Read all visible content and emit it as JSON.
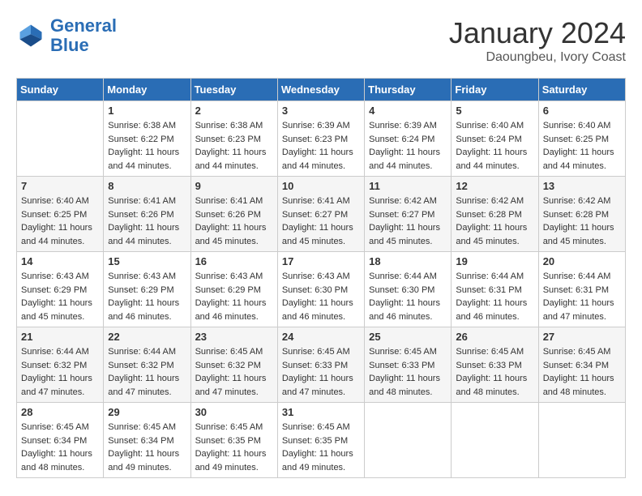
{
  "header": {
    "logo_general": "General",
    "logo_blue": "Blue",
    "month_title": "January 2024",
    "subtitle": "Daoungbeu, Ivory Coast"
  },
  "days_of_week": [
    "Sunday",
    "Monday",
    "Tuesday",
    "Wednesday",
    "Thursday",
    "Friday",
    "Saturday"
  ],
  "weeks": [
    [
      {
        "day": "",
        "sunrise": "",
        "sunset": "",
        "daylight": ""
      },
      {
        "day": "1",
        "sunrise": "Sunrise: 6:38 AM",
        "sunset": "Sunset: 6:22 PM",
        "daylight": "Daylight: 11 hours and 44 minutes."
      },
      {
        "day": "2",
        "sunrise": "Sunrise: 6:38 AM",
        "sunset": "Sunset: 6:23 PM",
        "daylight": "Daylight: 11 hours and 44 minutes."
      },
      {
        "day": "3",
        "sunrise": "Sunrise: 6:39 AM",
        "sunset": "Sunset: 6:23 PM",
        "daylight": "Daylight: 11 hours and 44 minutes."
      },
      {
        "day": "4",
        "sunrise": "Sunrise: 6:39 AM",
        "sunset": "Sunset: 6:24 PM",
        "daylight": "Daylight: 11 hours and 44 minutes."
      },
      {
        "day": "5",
        "sunrise": "Sunrise: 6:40 AM",
        "sunset": "Sunset: 6:24 PM",
        "daylight": "Daylight: 11 hours and 44 minutes."
      },
      {
        "day": "6",
        "sunrise": "Sunrise: 6:40 AM",
        "sunset": "Sunset: 6:25 PM",
        "daylight": "Daylight: 11 hours and 44 minutes."
      }
    ],
    [
      {
        "day": "7",
        "sunrise": "Sunrise: 6:40 AM",
        "sunset": "Sunset: 6:25 PM",
        "daylight": "Daylight: 11 hours and 44 minutes."
      },
      {
        "day": "8",
        "sunrise": "Sunrise: 6:41 AM",
        "sunset": "Sunset: 6:26 PM",
        "daylight": "Daylight: 11 hours and 44 minutes."
      },
      {
        "day": "9",
        "sunrise": "Sunrise: 6:41 AM",
        "sunset": "Sunset: 6:26 PM",
        "daylight": "Daylight: 11 hours and 45 minutes."
      },
      {
        "day": "10",
        "sunrise": "Sunrise: 6:41 AM",
        "sunset": "Sunset: 6:27 PM",
        "daylight": "Daylight: 11 hours and 45 minutes."
      },
      {
        "day": "11",
        "sunrise": "Sunrise: 6:42 AM",
        "sunset": "Sunset: 6:27 PM",
        "daylight": "Daylight: 11 hours and 45 minutes."
      },
      {
        "day": "12",
        "sunrise": "Sunrise: 6:42 AM",
        "sunset": "Sunset: 6:28 PM",
        "daylight": "Daylight: 11 hours and 45 minutes."
      },
      {
        "day": "13",
        "sunrise": "Sunrise: 6:42 AM",
        "sunset": "Sunset: 6:28 PM",
        "daylight": "Daylight: 11 hours and 45 minutes."
      }
    ],
    [
      {
        "day": "14",
        "sunrise": "Sunrise: 6:43 AM",
        "sunset": "Sunset: 6:29 PM",
        "daylight": "Daylight: 11 hours and 45 minutes."
      },
      {
        "day": "15",
        "sunrise": "Sunrise: 6:43 AM",
        "sunset": "Sunset: 6:29 PM",
        "daylight": "Daylight: 11 hours and 46 minutes."
      },
      {
        "day": "16",
        "sunrise": "Sunrise: 6:43 AM",
        "sunset": "Sunset: 6:29 PM",
        "daylight": "Daylight: 11 hours and 46 minutes."
      },
      {
        "day": "17",
        "sunrise": "Sunrise: 6:43 AM",
        "sunset": "Sunset: 6:30 PM",
        "daylight": "Daylight: 11 hours and 46 minutes."
      },
      {
        "day": "18",
        "sunrise": "Sunrise: 6:44 AM",
        "sunset": "Sunset: 6:30 PM",
        "daylight": "Daylight: 11 hours and 46 minutes."
      },
      {
        "day": "19",
        "sunrise": "Sunrise: 6:44 AM",
        "sunset": "Sunset: 6:31 PM",
        "daylight": "Daylight: 11 hours and 46 minutes."
      },
      {
        "day": "20",
        "sunrise": "Sunrise: 6:44 AM",
        "sunset": "Sunset: 6:31 PM",
        "daylight": "Daylight: 11 hours and 47 minutes."
      }
    ],
    [
      {
        "day": "21",
        "sunrise": "Sunrise: 6:44 AM",
        "sunset": "Sunset: 6:32 PM",
        "daylight": "Daylight: 11 hours and 47 minutes."
      },
      {
        "day": "22",
        "sunrise": "Sunrise: 6:44 AM",
        "sunset": "Sunset: 6:32 PM",
        "daylight": "Daylight: 11 hours and 47 minutes."
      },
      {
        "day": "23",
        "sunrise": "Sunrise: 6:45 AM",
        "sunset": "Sunset: 6:32 PM",
        "daylight": "Daylight: 11 hours and 47 minutes."
      },
      {
        "day": "24",
        "sunrise": "Sunrise: 6:45 AM",
        "sunset": "Sunset: 6:33 PM",
        "daylight": "Daylight: 11 hours and 47 minutes."
      },
      {
        "day": "25",
        "sunrise": "Sunrise: 6:45 AM",
        "sunset": "Sunset: 6:33 PM",
        "daylight": "Daylight: 11 hours and 48 minutes."
      },
      {
        "day": "26",
        "sunrise": "Sunrise: 6:45 AM",
        "sunset": "Sunset: 6:33 PM",
        "daylight": "Daylight: 11 hours and 48 minutes."
      },
      {
        "day": "27",
        "sunrise": "Sunrise: 6:45 AM",
        "sunset": "Sunset: 6:34 PM",
        "daylight": "Daylight: 11 hours and 48 minutes."
      }
    ],
    [
      {
        "day": "28",
        "sunrise": "Sunrise: 6:45 AM",
        "sunset": "Sunset: 6:34 PM",
        "daylight": "Daylight: 11 hours and 48 minutes."
      },
      {
        "day": "29",
        "sunrise": "Sunrise: 6:45 AM",
        "sunset": "Sunset: 6:34 PM",
        "daylight": "Daylight: 11 hours and 49 minutes."
      },
      {
        "day": "30",
        "sunrise": "Sunrise: 6:45 AM",
        "sunset": "Sunset: 6:35 PM",
        "daylight": "Daylight: 11 hours and 49 minutes."
      },
      {
        "day": "31",
        "sunrise": "Sunrise: 6:45 AM",
        "sunset": "Sunset: 6:35 PM",
        "daylight": "Daylight: 11 hours and 49 minutes."
      },
      {
        "day": "",
        "sunrise": "",
        "sunset": "",
        "daylight": ""
      },
      {
        "day": "",
        "sunrise": "",
        "sunset": "",
        "daylight": ""
      },
      {
        "day": "",
        "sunrise": "",
        "sunset": "",
        "daylight": ""
      }
    ]
  ]
}
